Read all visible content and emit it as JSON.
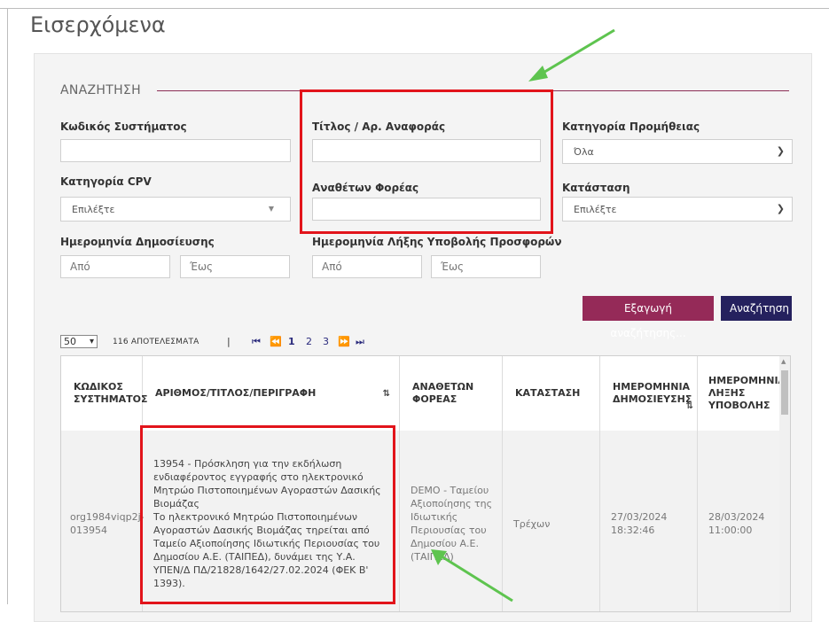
{
  "page_title": "Εισερχόμενα",
  "search": {
    "legend": "ΑΝΑΖΗΤΗΣΗ",
    "system_code_label": "Κωδικός Συστήματος",
    "title_ref_label": "Τίτλος / Αρ. Αναφοράς",
    "procurement_category_label": "Κατηγορία Προμήθειας",
    "procurement_category_value": "Όλα",
    "cpv_category_label": "Κατηγορία CPV",
    "cpv_category_value": "Επιλέξτε",
    "contracting_authority_label": "Αναθέτων Φορέας",
    "status_label": "Κατάσταση",
    "status_value": "Επιλέξτε",
    "publication_date_label": "Ημερομηνία Δημοσίευσης",
    "submission_deadline_label": "Ημερομηνία Λήξης Υποβολής Προσφορών",
    "from_placeholder": "Από",
    "to_placeholder": "Έως",
    "export_button": "Εξαγωγή αναζήτησης...",
    "search_button": "Αναζήτηση"
  },
  "results": {
    "per_page": "50",
    "count_text": "116 ΑΠΟΤΕΛΕΣΜΑΤΑ",
    "separator": "|",
    "first_icon": "⏮",
    "prev_icon": "⏪",
    "pages": [
      "1",
      "2",
      "3"
    ],
    "next_icon": "⏩",
    "last_icon": "⏭"
  },
  "table": {
    "columns": [
      "ΚΩΔΙΚΟΣ ΣΥΣΤΗΜΑΤΟΣ",
      "ΑΡΙΘΜΟΣ/ΤΙΤΛΟΣ/ΠΕΡΙΓΡΑΦΗ",
      "ΑΝΑΘΕΤΩΝ ΦΟΡΕΑΣ",
      "ΚΑΤΑΣΤΑΣΗ",
      "ΗΜΕΡΟΜΗΝΙΑ ΔΗΜΟΣΙΕΥΣΗΣ",
      "ΗΜΕΡΟΜΗΝΙΑ ΛΗΞΗΣ ΥΠΟΒΟΛΗΣ"
    ],
    "rows": [
      {
        "code": "org1984viqp2j-013954",
        "description": "13954 - Πρόσκληση για την εκδήλωση ενδιαφέροντος εγγραφής στο ηλεκτρονικό Μητρώο Πιστοποιημένων Αγοραστών Δασικής Βιομάζας\nΤο ηλεκτρονικό Μητρώο Πιστοποιημένων Αγοραστών Δασικής Βιομάζας τηρείται από Ταμείο Αξιοποίησης Ιδιωτικής Περιουσίας του Δημοσίου Α.Ε. (ΤΑΙΠΕΔ), δυνάμει της Υ.Α. ΥΠΕΝ/Δ ΠΔ/21828/1642/27.02.2024 (ΦΕΚ Β' 1393).",
        "authority": "DEMO - Ταμείου Αξιοποίησης της Ιδιωτικής Περιουσίας του Δημοσίου Α.Ε. (ΤΑΙΠΕΔ)",
        "status": "Τρέχων",
        "published": "27/03/2024 18:32:46",
        "deadline": "28/03/2024 11:00:00"
      }
    ]
  },
  "colors": {
    "accent_burgundy": "#952a58",
    "accent_navy": "#25215e",
    "highlight_red": "#e2141b",
    "arrow_green": "#5ec44f"
  }
}
